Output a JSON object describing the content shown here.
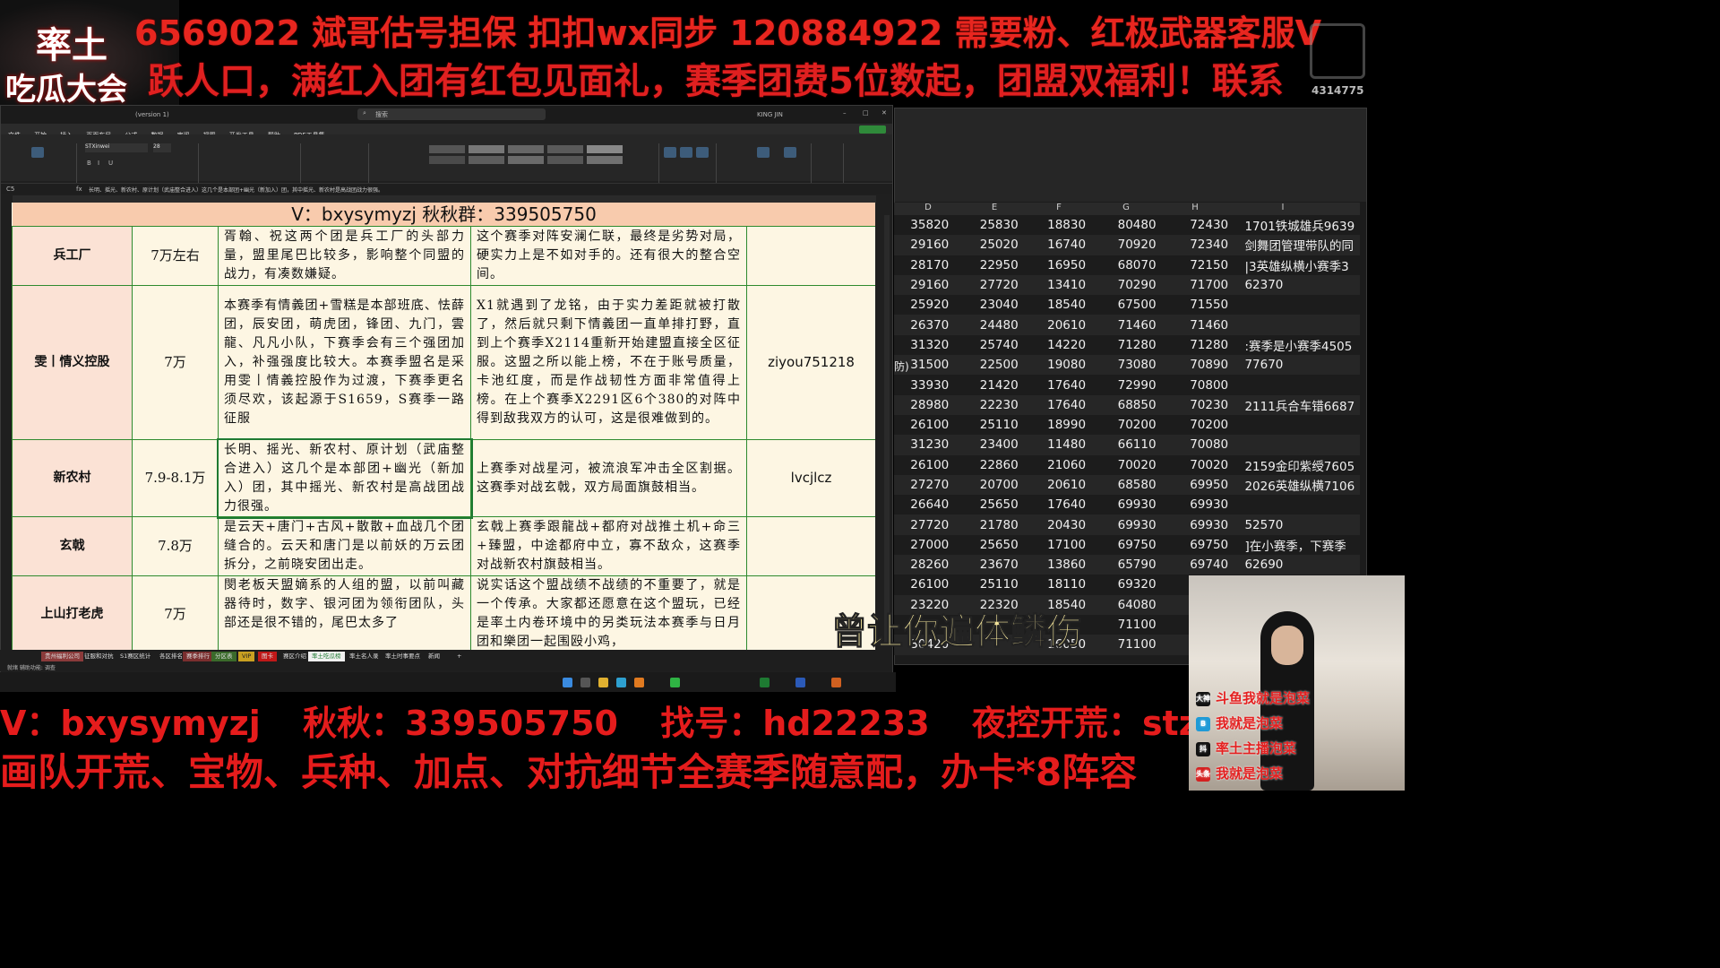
{
  "banner": {
    "line1": "6569022    斌哥估号担保 扣扣wx同步 120884922       需要粉、红极武器客服V",
    "line2": "跃人口，满红入团有红包见面礼，赛季团费5位数起，团盟双福利！联系",
    "logo_top": "率土",
    "logo_bottom": "吃瓜大会",
    "counter": "4314775"
  },
  "excel_left": {
    "search_placeholder": "搜索",
    "user": "KING JIN",
    "file_title": "(version 1)",
    "font_name": "STXinwei",
    "font_size": "28",
    "menu": [
      "文件",
      "开始",
      "插入",
      "页面布局",
      "公式",
      "数据",
      "审阅",
      "视图",
      "开发工具",
      "帮助",
      "PDF工具集"
    ],
    "ribbon_groups": [
      "剪贴板",
      "字体",
      "对齐方式",
      "数字",
      "样式",
      "单元格",
      "编辑",
      "分析",
      "保存和刷新"
    ],
    "cell_ref": "C5",
    "formula": "长明、摇光、新农村、原计划（武庙整合进入）这几个是本部团+幽光（新加入）团，其中摇光、新农村是高战团战力很强。",
    "header_row": "V：bxysymyzj 秋秋群：339505750",
    "rows": [
      {
        "name": "兵工厂",
        "power": "7万左右",
        "members": "胥翰、祝这两个团是兵工厂的头部力量，盟里尾巴比较多，影响整个同盟的战力，有凑数嫌疑。",
        "note": "这个赛季对阵安澜仁联，最终是劣势对局，硬实力上是不如对手的。还有很大的整合空间。",
        "contact": ""
      },
      {
        "name": "雯丨情义控股",
        "power": "7万",
        "members": "本赛季有情義团+雪糕是本部班底、怯薛团，辰安团，萌虎团，锋团、九门，雲龍、凡凡小队，下赛季会有三个强团加入，补强强度比较大。本赛季盟名是采用雯丨情義控股作为过渡，下赛季更名须尽欢，该起源于S1659，S赛季一路征服",
        "note": "X1就遇到了龙铭，由于实力差距就被打散了，然后就只剩下情義团一直单排打野，直到上个赛季X2114重新开始建盟直接全区征服。这盟之所以能上榜，不在于账号质量，卡池红度，而是作战韧性方面非常值得上榜。在上个赛季X2291区6个380的对阵中得到敌我双方的认可，这是很难做到的。",
        "contact": "ziyou751218"
      },
      {
        "name": "新农村",
        "power": "7.9-8.1万",
        "members": "长明、摇光、新农村、原计划（武庙整合进入）这几个是本部团+幽光（新加入）团，其中摇光、新农村是高战团战力很强。",
        "note": "上赛季对战星河，被流浪军冲击全区割据。这赛季对战玄戟，双方局面旗鼓相当。",
        "contact": "lvcjlcz"
      },
      {
        "name": "玄戟",
        "power": "7.8万",
        "members": "是云天+唐门+古风+散散+血战几个团缝合的。云天和唐门是以前妖的万云团拆分，之前晓安团出走。",
        "note": "玄戟上赛季跟龍战+都府对战推土机+命三+臻盟，中途都府中立，寡不敌众，这赛季对战新农村旗鼓相当。",
        "contact": ""
      },
      {
        "name": "上山打老虎",
        "power": "7万",
        "members": "閔老板天盟嫡系的人组的盟，以前叫藏器待时，数字、银河团为领衔团队，头部还是很不错的，尾巴太多了",
        "note": "说实话这个盟战绩不战绩的不重要了，就是一个传承。大家都还愿意在这个盟玩，已经是率土内卷环境中的另类玩法本赛季与日月团和樂团一起围殴小鸡，",
        "contact": ""
      }
    ],
    "sheet_tabs": [
      "贵州福利公司",
      "征服和对抗",
      "S1赛区统计",
      "各区排名",
      "赛季排行",
      "分区表",
      "VIP",
      "图卡",
      "赛区介绍",
      "率土吃瓜榜",
      "率土名人录",
      "率土时事要点",
      "新闻",
      "+"
    ],
    "status": "就绪  辅助功能: 调查"
  },
  "excel_right": {
    "columns": [
      "D",
      "E",
      "F",
      "G",
      "H",
      "I"
    ],
    "rows": [
      [
        "35820",
        "25830",
        "18830",
        "80480",
        "72430",
        "1701铁城雄兵9639"
      ],
      [
        "29160",
        "25020",
        "16740",
        "70920",
        "72340",
        "剑舞团管理带队的同"
      ],
      [
        "28170",
        "22950",
        "16950",
        "68070",
        "72150",
        "|3英雄纵横小赛季3"
      ],
      [
        "29160",
        "27720",
        "13410",
        "70290",
        "71700",
        "62370"
      ],
      [
        "25920",
        "23040",
        "18540",
        "67500",
        "71550",
        ""
      ],
      [
        "26370",
        "24480",
        "20610",
        "71460",
        "71460",
        ""
      ],
      [
        "31320",
        "25740",
        "14220",
        "71280",
        "71280",
        ":赛季是小赛季4505"
      ],
      [
        "31500",
        "22500",
        "19080",
        "73080",
        "70890",
        "77670"
      ],
      [
        "33930",
        "21420",
        "17640",
        "72990",
        "70800",
        ""
      ],
      [
        "28980",
        "22230",
        "17640",
        "68850",
        "70230",
        "2111兵合车错6687"
      ],
      [
        "26100",
        "25110",
        "18990",
        "70200",
        "70200",
        ""
      ],
      [
        "31230",
        "23400",
        "11480",
        "66110",
        "70080",
        ""
      ],
      [
        "26100",
        "22860",
        "21060",
        "70020",
        "70020",
        "2159金印紫绶7605"
      ],
      [
        "27270",
        "20700",
        "20610",
        "68580",
        "69950",
        "2026英雄纵横7106"
      ],
      [
        "26640",
        "25650",
        "17640",
        "69930",
        "69930",
        ""
      ],
      [
        "27720",
        "21780",
        "20430",
        "69930",
        "69930",
        "52570"
      ],
      [
        "27000",
        "25650",
        "17100",
        "69750",
        "69750",
        "]在小赛季，下赛季"
      ],
      [
        "28260",
        "23670",
        "13860",
        "65790",
        "69740",
        "62690"
      ],
      [
        "26100",
        "25110",
        "18110",
        "69320",
        "",
        ""
      ],
      [
        "23220",
        "22320",
        "18540",
        "64080",
        "",
        ""
      ],
      [
        "",
        "",
        "",
        "71100",
        "",
        ""
      ],
      [
        "30420",
        "",
        "16050",
        "71100",
        "",
        ""
      ]
    ],
    "side_label": "防)"
  },
  "caption": "曾让你遍体鳞伤",
  "bottom": {
    "line1": [
      "V：bxysymyzj",
      "秋秋：339505750",
      "找号：hd22233",
      "夜控开荒：stzb023"
    ],
    "line2": "画队开荒、宝物、兵种、加点、对抗细节全赛季随意配，办卡*8阵容"
  },
  "camera": {
    "lines": [
      {
        "icon": "大神",
        "text": "斗鱼我就是泡菜"
      },
      {
        "icon": "B",
        "text": "我就是泡菜"
      },
      {
        "icon": "抖",
        "text": "率土主播泡菜"
      },
      {
        "icon": "头条",
        "text": "我就是泡菜"
      }
    ]
  }
}
